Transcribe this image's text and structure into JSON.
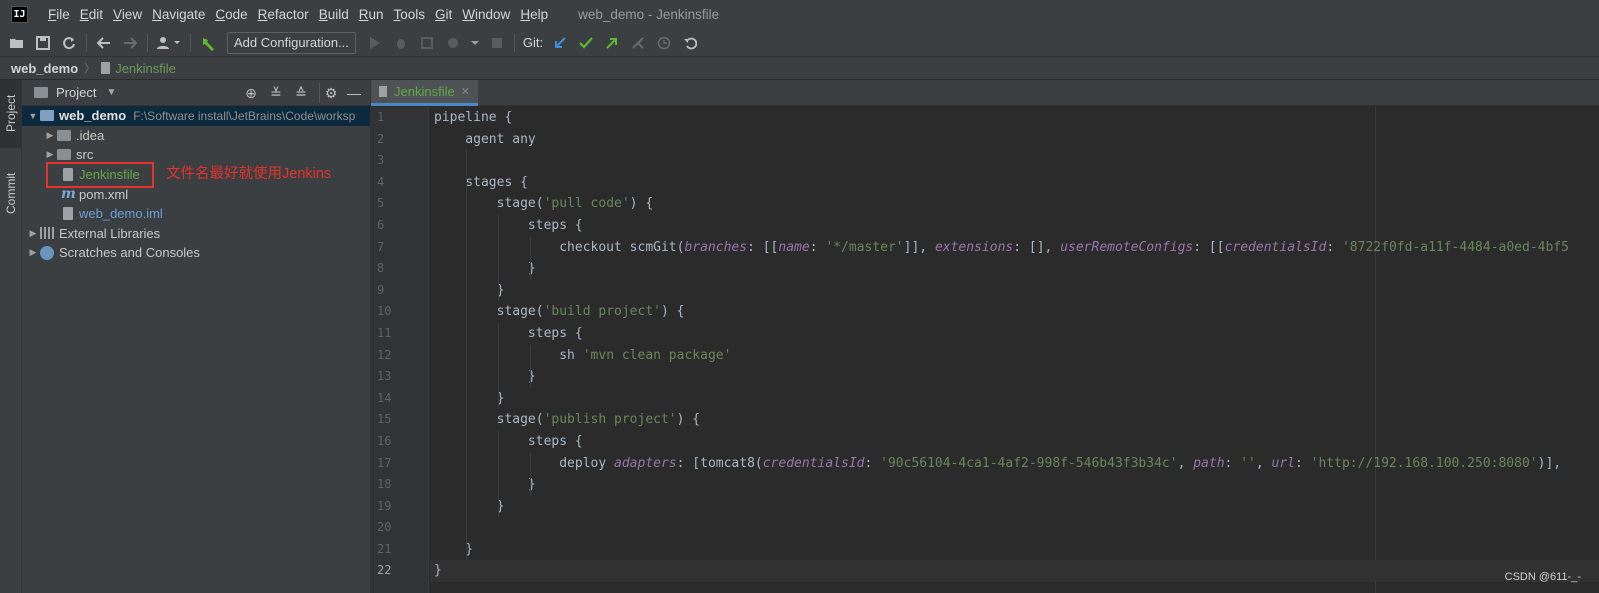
{
  "menubar": {
    "logo": "IJ",
    "items": [
      {
        "mnemonic": "F",
        "rest": "ile"
      },
      {
        "mnemonic": "E",
        "rest": "dit"
      },
      {
        "mnemonic": "V",
        "rest": "iew"
      },
      {
        "mnemonic": "N",
        "rest": "avigate"
      },
      {
        "mnemonic": "C",
        "rest": "ode"
      },
      {
        "mnemonic": "R",
        "rest": "efactor"
      },
      {
        "mnemonic": "B",
        "rest": "uild"
      },
      {
        "mnemonic": "R",
        "rest": "un"
      },
      {
        "mnemonic": "T",
        "rest": "ools"
      },
      {
        "mnemonic": "G",
        "rest": "it"
      },
      {
        "mnemonic": "W",
        "rest": "indow"
      },
      {
        "mnemonic": "H",
        "rest": "elp"
      }
    ],
    "window_title": "web_demo - Jenkinsfile"
  },
  "toolbar": {
    "add_configuration": "Add Configuration...",
    "git_label": "Git:",
    "colors": {
      "update": "#3d8fd6",
      "commit": "#5fb832",
      "push": "#5fb832"
    }
  },
  "breadcrumb": {
    "root": "web_demo",
    "file": "Jenkinsfile"
  },
  "tool_strip": {
    "project": "Project",
    "commit": "Commit"
  },
  "project_panel": {
    "title": "Project",
    "tree": {
      "root_name": "web_demo",
      "root_path": "F:\\Software install\\JetBrains\\Code\\worksp",
      "idea": ".idea",
      "src": "src",
      "jenkinsfile": "Jenkinsfile",
      "pom": "pom.xml",
      "iml": "web_demo.iml",
      "external_libraries": "External Libraries",
      "scratches": "Scratches and Consoles"
    },
    "annotation": "文件名最好就使用Jenkins"
  },
  "editor": {
    "tab_label": "Jenkinsfile",
    "line_numbers": [
      "1",
      "2",
      "3",
      "4",
      "5",
      "6",
      "7",
      "8",
      "9",
      "10",
      "11",
      "12",
      "13",
      "14",
      "15",
      "16",
      "17",
      "18",
      "19",
      "20",
      "21",
      "22"
    ],
    "current_line": "22",
    "code": {
      "l1": "pipeline {",
      "l2": "    agent any",
      "l4": "    stages {",
      "l5_a": "        stage(",
      "l5_s": "'pull code'",
      "l5_b": ") {",
      "l6": "            steps {",
      "l7_a": "                checkout scmGit(",
      "l7_p1": "branches",
      "l7_b": ": [[",
      "l7_p2": "name",
      "l7_c": ": ",
      "l7_s1": "'*/master'",
      "l7_d": "]], ",
      "l7_p3": "extensions",
      "l7_e": ": [], ",
      "l7_p4": "userRemoteConfigs",
      "l7_f": ": [[",
      "l7_p5": "credentialsId",
      "l7_g": ": ",
      "l7_s2": "'8722f0fd-a11f-4484-a0ed-4bf5",
      "l8": "            }",
      "l9": "        }",
      "l10_a": "        stage(",
      "l10_s": "'build project'",
      "l10_b": ") {",
      "l11": "            steps {",
      "l12_a": "                sh ",
      "l12_s": "'mvn clean package'",
      "l13": "            }",
      "l14": "        }",
      "l15_a": "        stage(",
      "l15_s": "'publish project'",
      "l15_b": ") {",
      "l16": "            steps {",
      "l17_a": "                deploy ",
      "l17_p1": "adapters",
      "l17_b": ": [tomcat8(",
      "l17_p2": "credentialsId",
      "l17_c": ": ",
      "l17_s1": "'90c56104-4ca1-4af2-998f-546b43f3b34c'",
      "l17_d": ", ",
      "l17_p3": "path",
      "l17_e": ": ",
      "l17_s2": "''",
      "l17_f": ", ",
      "l17_p4": "url",
      "l17_g": ": ",
      "l17_s3": "'http://192.168.100.250:8080'",
      "l17_h": ")],",
      "l18": "            }",
      "l19": "        }",
      "l21": "    }",
      "l22": "}"
    }
  },
  "watermark": "CSDN @611-_-"
}
